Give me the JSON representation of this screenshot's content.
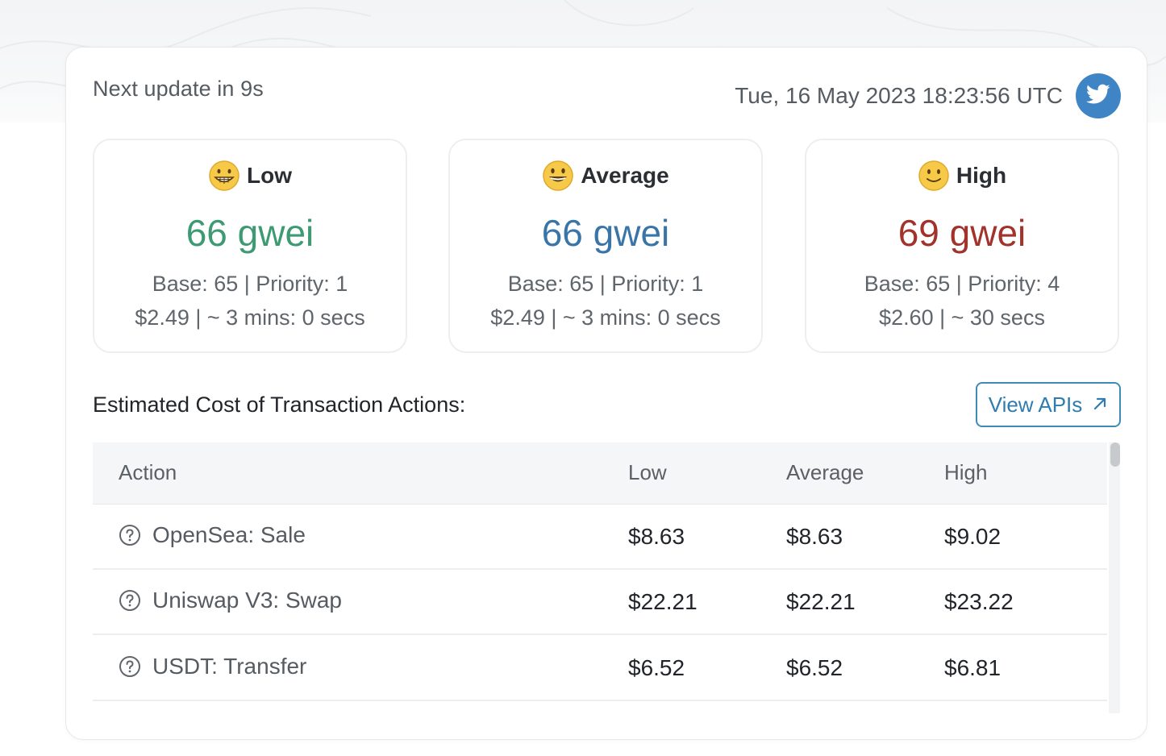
{
  "header": {
    "next_update": "Next update in 9s",
    "timestamp": "Tue, 16 May 2023 18:23:56 UTC",
    "twitter_icon": "twitter-bird-icon"
  },
  "gas": {
    "low": {
      "label": "Low",
      "emoji": "grinning-face-with-teeth",
      "gwei": "66 gwei",
      "line1": "Base: 65 | Priority: 1",
      "line2": "$2.49 | ~ 3 mins: 0 secs",
      "color": "#3e9a73"
    },
    "average": {
      "label": "Average",
      "emoji": "grinning-face",
      "gwei": "66 gwei",
      "line1": "Base: 65 | Priority: 1",
      "line2": "$2.49 | ~ 3 mins: 0 secs",
      "color": "#3a75a8"
    },
    "high": {
      "label": "High",
      "emoji": "slightly-smiling-face",
      "gwei": "69 gwei",
      "line1": "Base: 65 | Priority: 4",
      "line2": "$2.60 | ~ 30 secs",
      "color": "#a2322c"
    }
  },
  "section": {
    "title": "Estimated Cost of Transaction Actions:",
    "view_apis": "View APIs"
  },
  "table": {
    "headers": {
      "action": "Action",
      "low": "Low",
      "average": "Average",
      "high": "High"
    },
    "rows": [
      {
        "action": "OpenSea: Sale",
        "low": "$8.63",
        "average": "$8.63",
        "high": "$9.02"
      },
      {
        "action": "Uniswap V3: Swap",
        "low": "$22.21",
        "average": "$22.21",
        "high": "$23.22"
      },
      {
        "action": "USDT: Transfer",
        "low": "$6.52",
        "average": "$6.52",
        "high": "$6.81"
      }
    ]
  },
  "colors": {
    "accent_blue": "#3f85c6",
    "button_border": "#3f8bb8"
  }
}
